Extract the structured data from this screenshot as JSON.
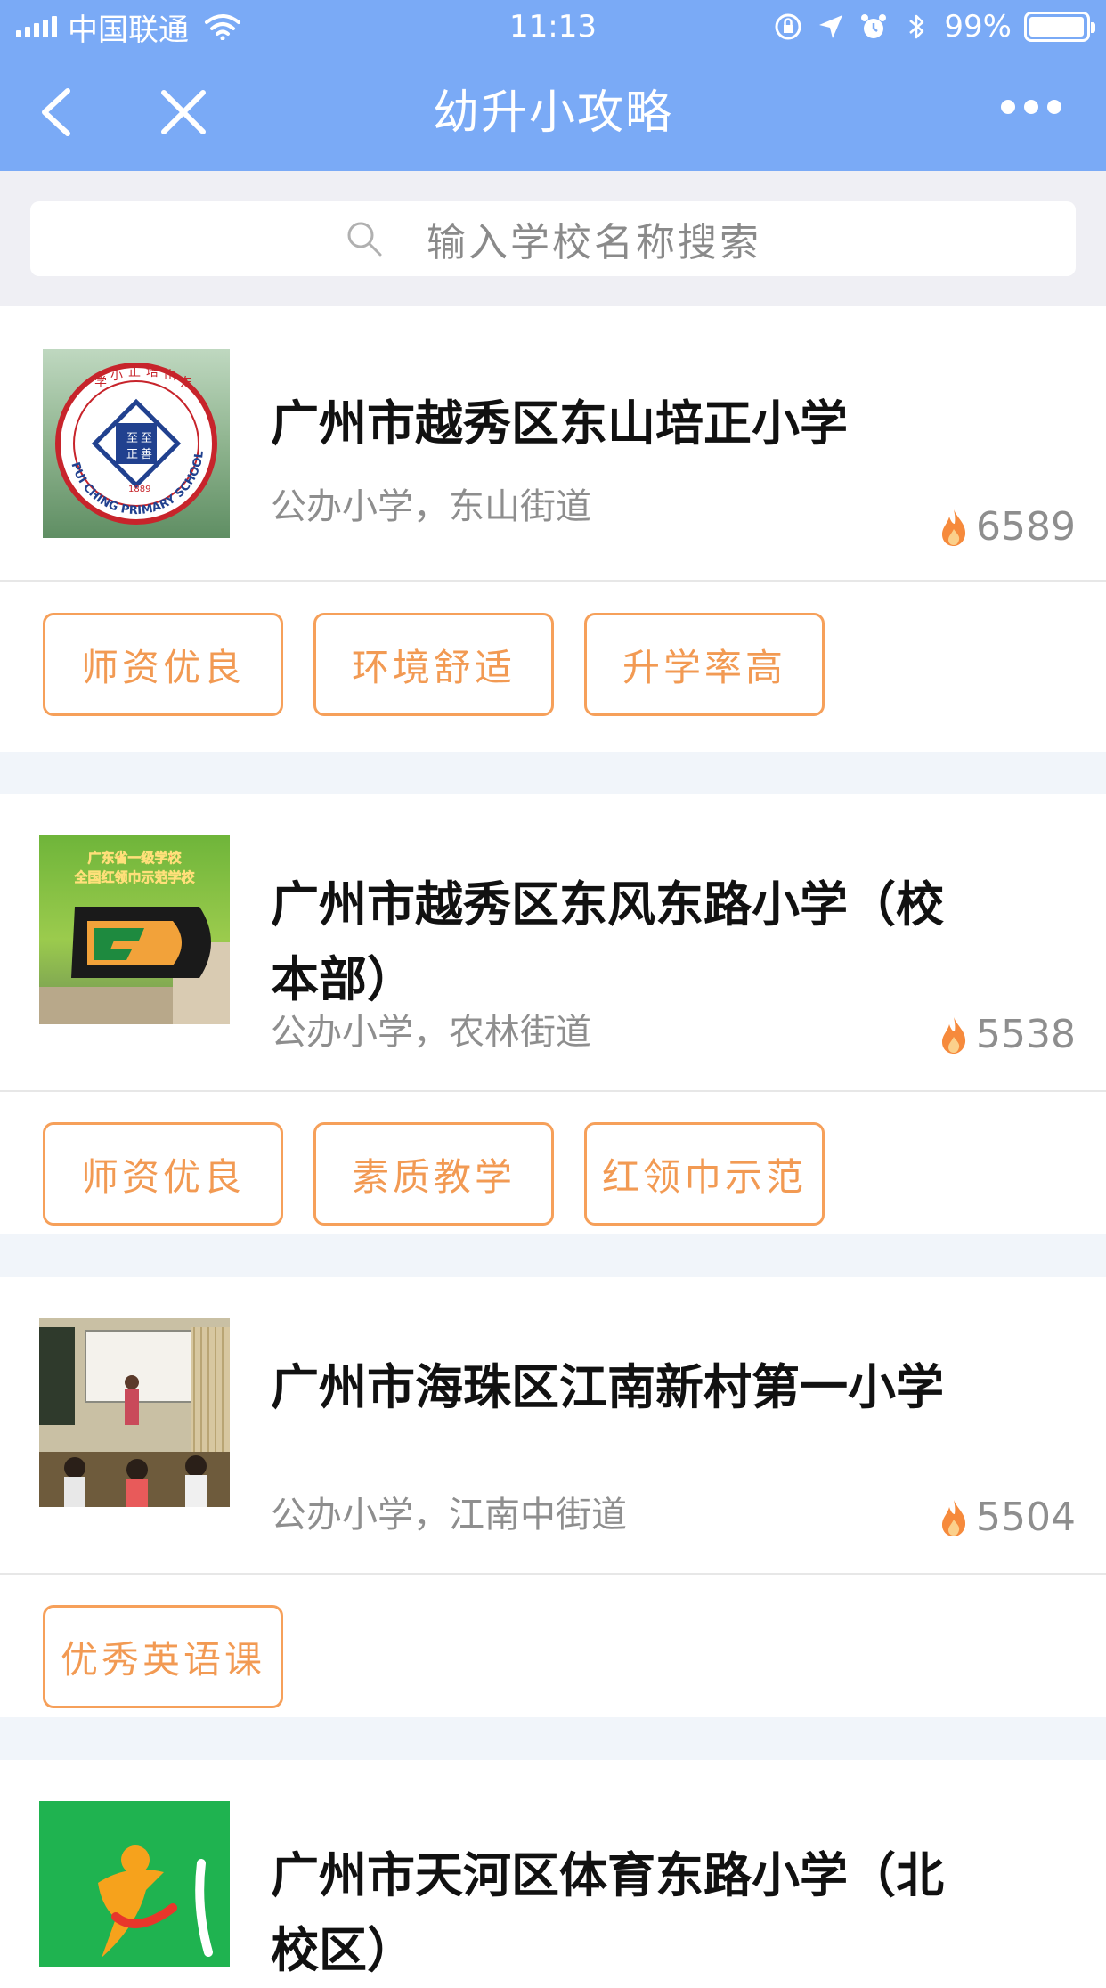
{
  "status_bar": {
    "carrier": "中国联通",
    "time": "11:13",
    "battery": "99%",
    "battery_level": 0.99
  },
  "nav": {
    "title": "幼升小攻略",
    "back_icon": "chevron-left-icon",
    "close_icon": "close-icon",
    "more_icon": "more-icon"
  },
  "search": {
    "placeholder": "输入学校名称搜索",
    "icon": "search-icon"
  },
  "schools": [
    {
      "name": "广州市越秀区东山培正小学",
      "meta": "公办小学，东山街道",
      "heat": "6589",
      "tags": [
        "师资优良",
        "环境舒适",
        "升学率高"
      ],
      "logo_text": [
        "东",
        "山",
        "培",
        "正",
        "小",
        "学"
      ],
      "logo_en": "PUI CHING PRIMARY SCHOOL",
      "logo_center": [
        "至",
        "至",
        "善",
        "正"
      ],
      "logo_year": "1889"
    },
    {
      "name": "广州市越秀区东风东路小学（校本部）",
      "meta": "公办小学，农林街道",
      "heat": "5538",
      "tags": [
        "师资优良",
        "素质教学",
        "红领巾示范"
      ],
      "logo_lines": [
        "广东省一级学校",
        "全国红领巾示范学校"
      ]
    },
    {
      "name": "广州市海珠区江南新村第一小学",
      "meta": "公办小学，江南中街道",
      "heat": "5504",
      "tags": [
        "优秀英语课"
      ]
    },
    {
      "name": "广州市天河区体育东路小学（北校区）",
      "meta": "",
      "heat": "",
      "tags": []
    }
  ]
}
